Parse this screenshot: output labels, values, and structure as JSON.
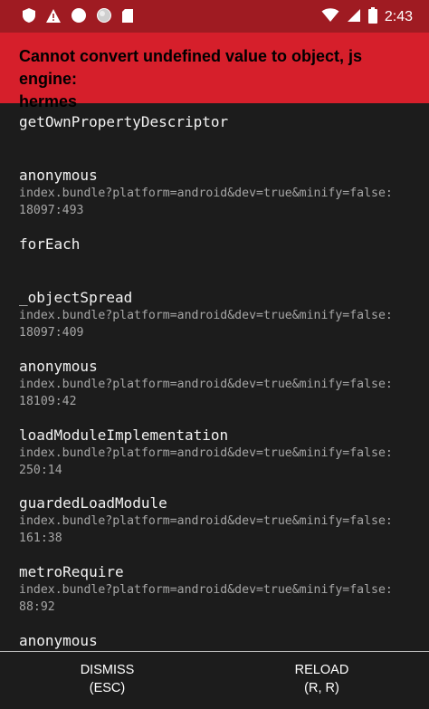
{
  "status_bar": {
    "time": "2:43",
    "left_icons": [
      "shield-icon",
      "warning-icon",
      "circle-icon",
      "circle-outline-icon",
      "sd-card-icon"
    ],
    "right_icons": [
      "wifi-icon",
      "signal-icon",
      "battery-icon"
    ]
  },
  "error": {
    "title_line1": "Cannot convert undefined value to object, js engine:",
    "title_line2": "hermes"
  },
  "stack_frames": [
    {
      "method": "getOwnPropertyDescriptor",
      "location_line1": "",
      "location_line2": ""
    },
    {
      "method": "anonymous",
      "location_line1": "index.bundle?platform=android&dev=true&minify=false:",
      "location_line2": "18097:493"
    },
    {
      "method": "forEach",
      "location_line1": "",
      "location_line2": ""
    },
    {
      "method": "_objectSpread",
      "location_line1": "index.bundle?platform=android&dev=true&minify=false:",
      "location_line2": "18097:409"
    },
    {
      "method": "anonymous",
      "location_line1": "index.bundle?platform=android&dev=true&minify=false:",
      "location_line2": "18109:42"
    },
    {
      "method": "loadModuleImplementation",
      "location_line1": "index.bundle?platform=android&dev=true&minify=false:",
      "location_line2": "250:14"
    },
    {
      "method": "guardedLoadModule",
      "location_line1": "index.bundle?platform=android&dev=true&minify=false:",
      "location_line2": "161:38"
    },
    {
      "method": "metroRequire",
      "location_line1": "index.bundle?platform=android&dev=true&minify=false:",
      "location_line2": "88:92"
    },
    {
      "method": "anonymous",
      "location_line1": "",
      "location_line2": ""
    }
  ],
  "footer": {
    "dismiss_label": "DISMISS",
    "dismiss_shortcut": "(ESC)",
    "reload_label": "RELOAD",
    "reload_shortcut": "(R, R)"
  },
  "colors": {
    "status_bar": "#9f1b22",
    "error_header": "#d61f2b",
    "background": "#1c1c1c",
    "method_text": "#f2f2f2",
    "location_text": "#a6a6a6"
  }
}
